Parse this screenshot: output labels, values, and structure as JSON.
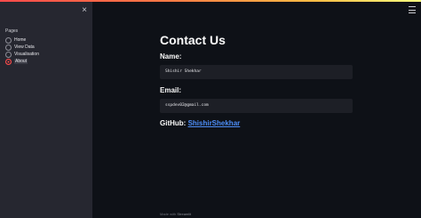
{
  "sidebar": {
    "close_icon": "×",
    "pages_label": "Pages",
    "items": [
      {
        "label": "Home",
        "selected": false
      },
      {
        "label": "View Data",
        "selected": false
      },
      {
        "label": "Visualisation",
        "selected": false
      },
      {
        "label": "About",
        "selected": true
      }
    ]
  },
  "header": {
    "menu_icon": "hamburger-menu-icon"
  },
  "main": {
    "title": "Contact Us",
    "name_label": "Name:",
    "name_value": "Shishir Shekhar",
    "email_label": "Email:",
    "email_value": "sspdev02@gmail.com",
    "github_label": "GitHub:",
    "github_link": "ShishirShekhar"
  },
  "footer": {
    "prefix": "Made with",
    "brand": "Streamlit"
  },
  "colors": {
    "accent": "#ff4b4b",
    "link": "#4d8df6",
    "background": "#0e1117",
    "sidebar": "#262730"
  }
}
